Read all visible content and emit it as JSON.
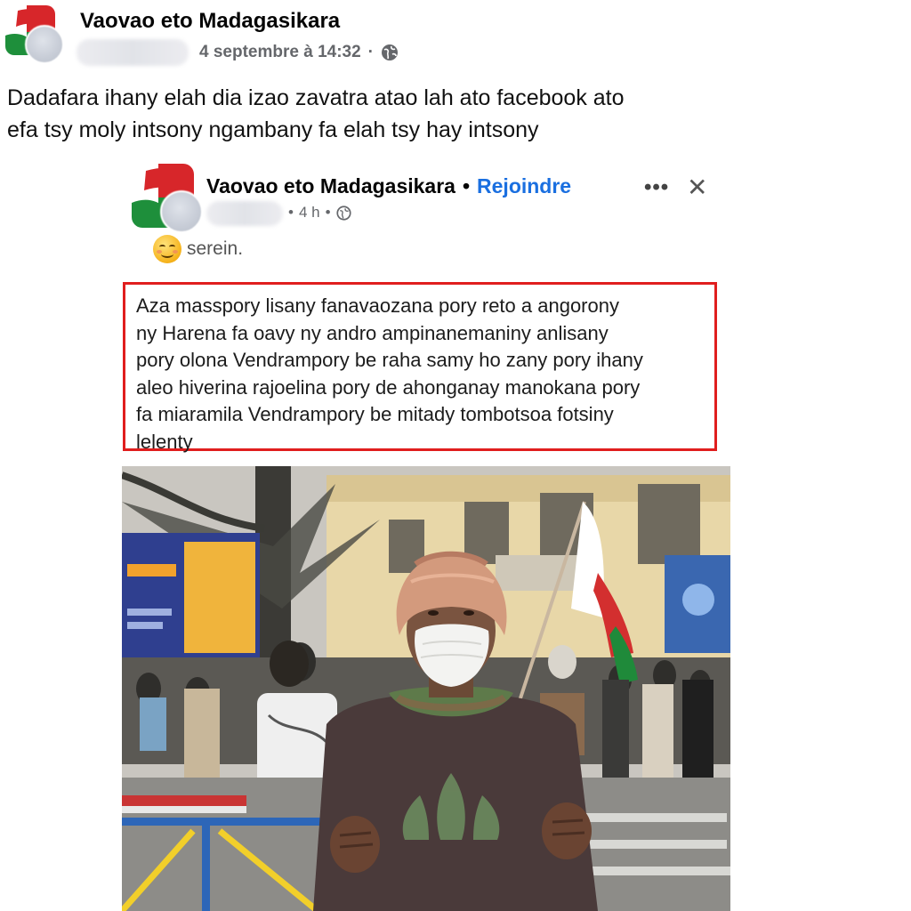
{
  "outer_post": {
    "group_name": "Vaovao eto Madagasikara",
    "timestamp": "4 septembre à 14:32",
    "separator": "·",
    "privacy_icon": "globe-icon",
    "text_lines": [
      "Dadafara ihany elah dia izao zavatra atao lah ato facebook ato",
      "efa tsy moly intsony ngambany fa elah tsy hay intsony"
    ]
  },
  "shared_post": {
    "group_name": "Vaovao eto Madagasikara",
    "dot": "•",
    "join_label": "Rejoindre",
    "time": "4 h",
    "meta_dot": "•",
    "privacy_icon": "globe-icon",
    "more_icon": "•••",
    "close_icon": "✕",
    "feeling_emoji": "smiling-face-icon",
    "feeling_text": "serein.",
    "highlighted_text_lines": [
      "Aza masspory lisany fanavaozana pory reto a angorony",
      "ny Harena fa oavy ny andro ampinanemaniny anlisany",
      "pory olona Vendrampory be raha samy ho zany pory ihany",
      "aleo hiverina rajoelina pory de ahonganay manokana pory",
      "fa miaramila Vendrampory be mitady tombotsoa fotsiny",
      "lelenty"
    ],
    "highlight_color": "#e01e1e",
    "photo": {
      "description_icon": "protest-photo",
      "colors": {
        "flag_white": "#ffffff",
        "flag_red": "#d32f2f",
        "flag_green": "#1f8a3a"
      }
    }
  },
  "colors": {
    "link_blue": "#1a6fe0",
    "meta_gray": "#65676b"
  }
}
